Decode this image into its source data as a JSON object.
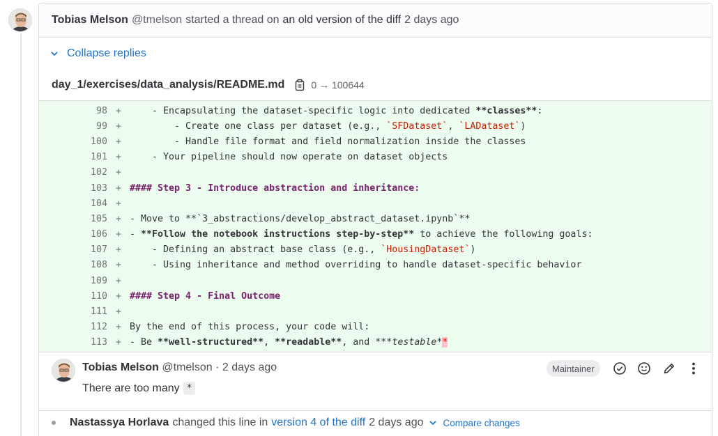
{
  "thread": {
    "author": "Tobias Melson",
    "handle": "@tmelson",
    "verb": "started a thread on",
    "link": "an old version of the diff",
    "time": "2 days ago"
  },
  "collapse_label": "Collapse replies",
  "file": {
    "path": "day_1/exercises/data_analysis/README.md",
    "mode": "0 → 100644"
  },
  "diff_lines": [
    {
      "num": "98"
    },
    {
      "num": "99"
    },
    {
      "num": "100"
    },
    {
      "num": "101"
    },
    {
      "num": "102"
    },
    {
      "num": "103"
    },
    {
      "num": "104"
    },
    {
      "num": "105"
    },
    {
      "num": "106"
    },
    {
      "num": "107"
    },
    {
      "num": "108"
    },
    {
      "num": "109"
    },
    {
      "num": "110"
    },
    {
      "num": "111"
    },
    {
      "num": "112"
    },
    {
      "num": "113"
    }
  ],
  "diff_code": {
    "l98": [
      "    - Encapsulating the dataset-specific logic into dedicated ",
      "**classes**",
      ":"
    ],
    "l99": [
      "        - Create one class per dataset (e.g., ",
      "`SFDataset`",
      ", ",
      "`LADataset`",
      ")"
    ],
    "l100": "        - Handle file format and field normalization inside the classes",
    "l101": "    - Your pipeline should now operate on dataset objects",
    "l103": "#### Step 3 - Introduce abstraction and inheritance:",
    "l105": "- Move to **`3_abstractions/develop_abstract_dataset.ipynb`**",
    "l106": [
      "- ",
      "**Follow the notebook instructions step-by-step**",
      " to achieve the following goals:"
    ],
    "l107": [
      "    - Defining an abstract base class (e.g., ",
      "`HousingDataset`",
      ")"
    ],
    "l108": "    - Using inheritance and method overriding to handle dataset-specific behavior",
    "l110": "#### Step 4 - Final Outcome",
    "l112": "By the end of this process, your code will:",
    "l113": [
      "- Be ",
      "**well-structured**",
      ", ",
      "**readable**",
      ", and ",
      "***",
      "testable",
      "*",
      "*"
    ]
  },
  "plus_sign": "+",
  "note": {
    "author": "Tobias Melson",
    "handle": "@tmelson",
    "separator": "·",
    "time": "2 days ago",
    "badge": "Maintainer",
    "body": "There are too many",
    "code": "*"
  },
  "system_note": {
    "author": "Nastassya Horlava",
    "text1": "changed this line in",
    "link": "version 4 of the diff",
    "time": "2 days ago",
    "compare": "Compare changes"
  },
  "icons": [
    "chevron-down-icon",
    "copy-icon",
    "check-circle-icon",
    "smile-icon",
    "pencil-icon",
    "ellipsis-v-icon"
  ]
}
